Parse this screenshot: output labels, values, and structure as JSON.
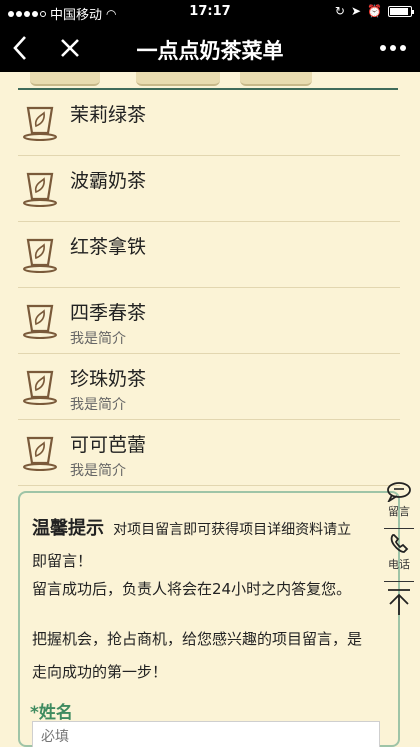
{
  "status_bar": {
    "carrier": "中国移动",
    "time": "17:17"
  },
  "nav": {
    "title": "一点点奶茶菜单",
    "back_icon": "chevron-left-icon",
    "close_icon": "close-icon",
    "more_icon": "more-dots-icon"
  },
  "menu": {
    "items": [
      {
        "name": "茉莉绿茶",
        "desc": ""
      },
      {
        "name": "波霸奶茶",
        "desc": ""
      },
      {
        "name": "红茶拿铁",
        "desc": ""
      },
      {
        "name": "四季春茶",
        "desc": "我是简介"
      },
      {
        "name": "珍珠奶茶",
        "desc": "我是简介"
      },
      {
        "name": "可可芭蕾",
        "desc": "我是简介"
      }
    ]
  },
  "notice": {
    "title": "温馨提示",
    "subtitle": "对项目留言即可获得项目详细资料请立",
    "line1": "即留言！",
    "line2": "留言成功后，负责人将会在24小时之内答复您。",
    "line3": "把握机会，抢占商机，给您感兴趣的项目留言，是",
    "line4": "走向成功的第一步！",
    "name_label": "*姓名",
    "name_placeholder": "必填"
  },
  "side": {
    "message_label": "留言",
    "phone_label": "电话"
  },
  "colors": {
    "background": "#fbf3d6",
    "accent_green": "#3f8b60",
    "border_green": "#9ec4a7",
    "bar": "#000000"
  }
}
